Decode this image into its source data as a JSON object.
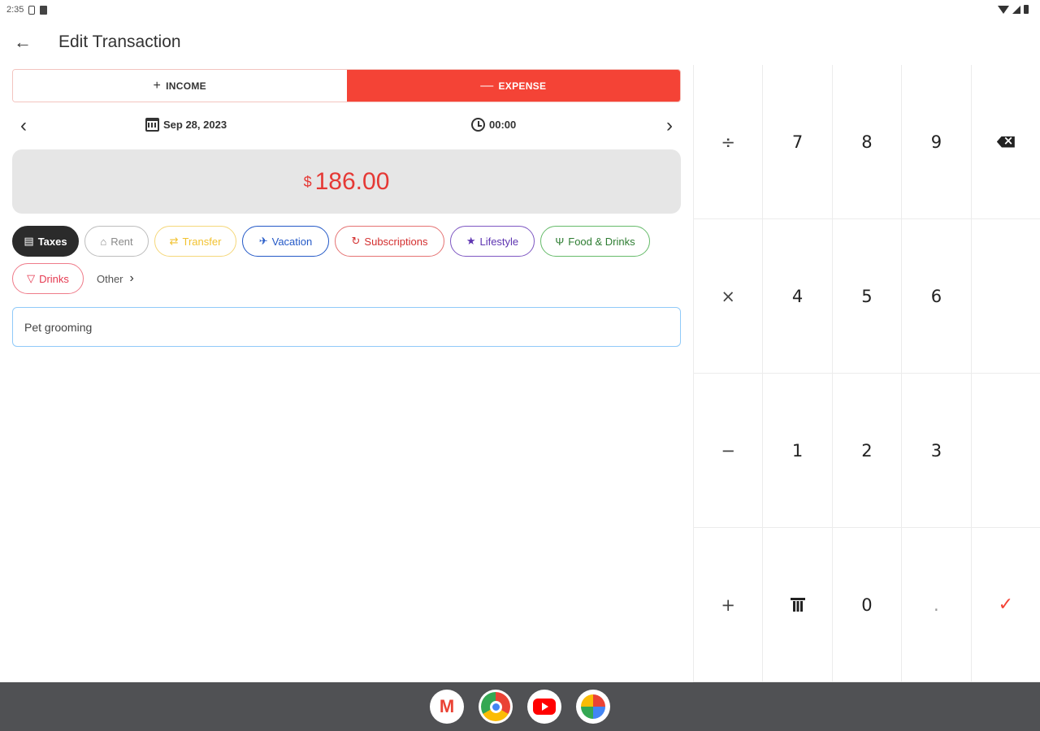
{
  "status_bar": {
    "time": "2:35"
  },
  "app_bar": {
    "title": "Edit Transaction"
  },
  "type_toggle": {
    "income": {
      "symbol": "+",
      "label": "INCOME"
    },
    "expense": {
      "symbol": "—",
      "label": "EXPENSE"
    },
    "selected": "expense"
  },
  "date_row": {
    "date": "Sep 28, 2023",
    "time": "00:00"
  },
  "amount": {
    "currency": "$",
    "value": "186.00"
  },
  "categories": {
    "taxes": {
      "icon": "▤",
      "label": "Taxes",
      "selected": true
    },
    "rent": {
      "icon": "⌂",
      "label": "Rent"
    },
    "transfer": {
      "icon": "⇄",
      "label": "Transfer"
    },
    "vacation": {
      "icon": "✈",
      "label": "Vacation"
    },
    "subscriptions": {
      "icon": "↻",
      "label": "Subscriptions"
    },
    "lifestyle": {
      "icon": "★",
      "label": "Lifestyle"
    },
    "food": {
      "icon": "Ψ",
      "label": "Food & Drinks"
    },
    "drinks": {
      "icon": "▽",
      "label": "Drinks"
    },
    "other": {
      "label": "Other",
      "chevron": "›"
    }
  },
  "note": {
    "value": "Pet grooming"
  },
  "keypad": {
    "divide": "÷",
    "seven": "7",
    "eight": "8",
    "nine": "9",
    "multiply": "×",
    "four": "4",
    "five": "5",
    "six": "6",
    "minus": "−",
    "one": "1",
    "two": "2",
    "three": "3",
    "plus": "+",
    "zero": "0",
    "dot": ".",
    "confirm": "✓"
  },
  "colors": {
    "expense_accent": "#f44336",
    "amount_text": "#e53935",
    "taskbar": "#505154"
  },
  "taskbar_apps": [
    "gmail-icon",
    "chrome-icon",
    "youtube-icon",
    "photos-icon"
  ]
}
